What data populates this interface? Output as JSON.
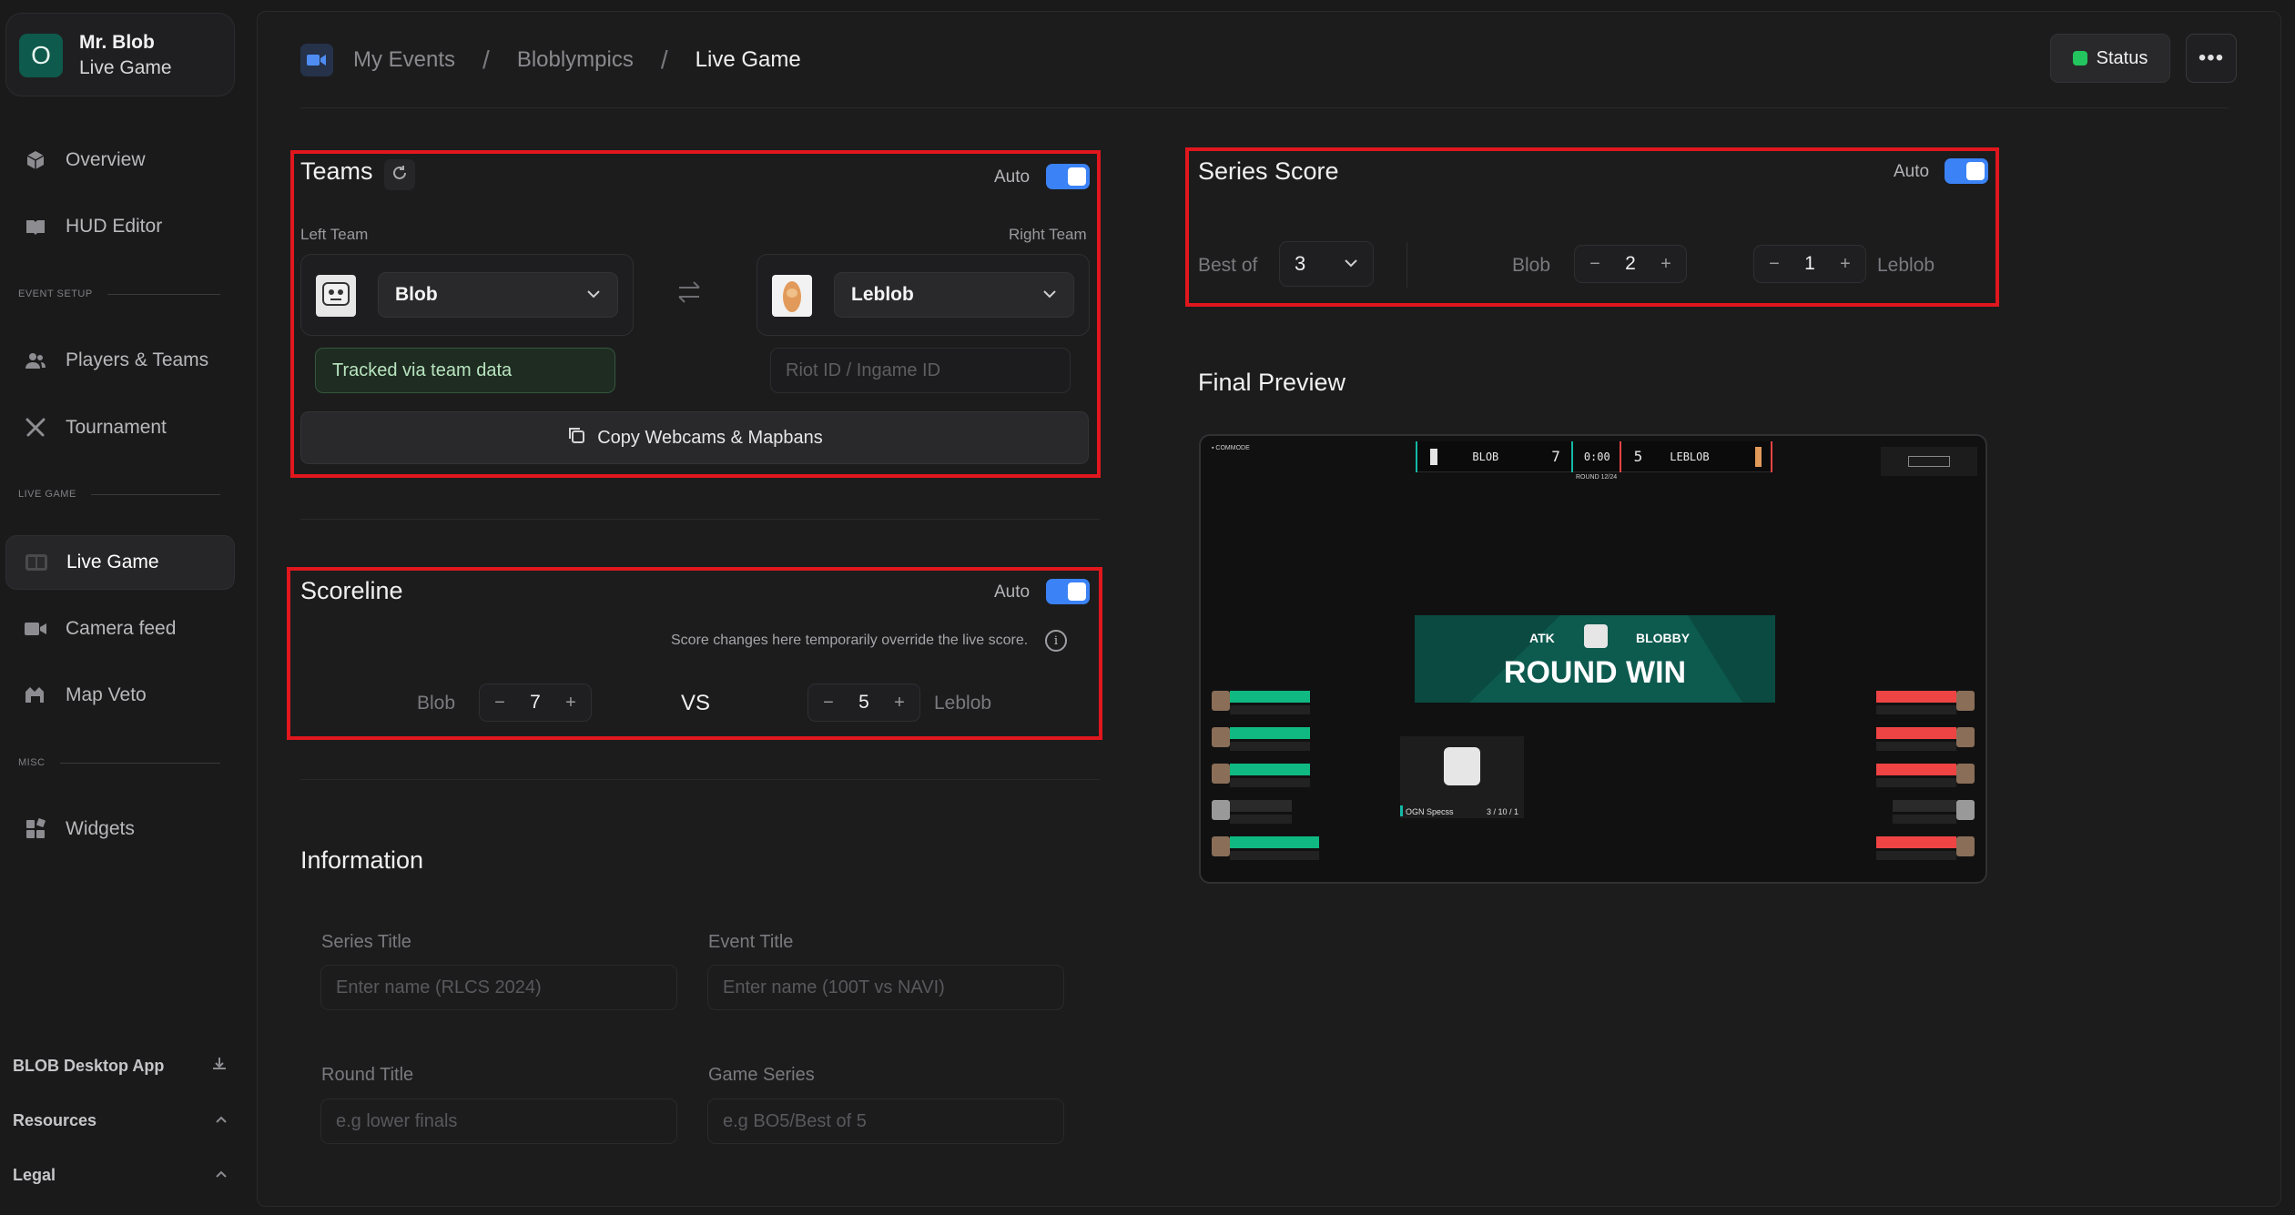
{
  "account": {
    "initial": "O",
    "name": "Mr. Blob",
    "subtitle": "Live Game"
  },
  "sidebar": {
    "items": [
      {
        "label": "Overview",
        "icon": "cube-icon"
      },
      {
        "label": "HUD Editor",
        "icon": "book-icon"
      },
      {
        "label": "Players & Teams",
        "icon": "users-icon"
      },
      {
        "label": "Tournament",
        "icon": "swords-icon"
      },
      {
        "label": "Live Game",
        "icon": "live-game-icon"
      },
      {
        "label": "Camera feed",
        "icon": "video-icon"
      },
      {
        "label": "Map Veto",
        "icon": "map-veto-icon"
      },
      {
        "label": "Widgets",
        "icon": "widgets-icon"
      }
    ],
    "sections": {
      "event_setup": "EVENT SETUP",
      "live_game": "LIVE GAME",
      "misc": "MISC"
    },
    "bottom": {
      "desktop_app": "BLOB Desktop App",
      "resources": "Resources",
      "legal": "Legal"
    }
  },
  "breadcrumb": {
    "items": [
      "My Events",
      "Bloblympics",
      "Live Game"
    ],
    "separator": "/"
  },
  "header": {
    "status_label": "Status",
    "more_label": "•••"
  },
  "teams": {
    "title": "Teams",
    "auto_label": "Auto",
    "auto_on": true,
    "left_label": "Left Team",
    "right_label": "Right Team",
    "left_team": "Blob",
    "right_team": "Leblob",
    "tracked_text": "Tracked via team data",
    "riot_placeholder": "Riot ID / Ingame ID",
    "copy_label": "Copy Webcams & Mapbans"
  },
  "scoreline": {
    "title": "Scoreline",
    "auto_label": "Auto",
    "auto_on": true,
    "note": "Score changes here temporarily override the live score.",
    "left_team": "Blob",
    "left_score": "7",
    "vs": "VS",
    "right_score": "5",
    "right_team": "Leblob",
    "minus": "−",
    "plus": "+"
  },
  "series_score": {
    "title": "Series Score",
    "auto_label": "Auto",
    "auto_on": true,
    "best_of_label": "Best of",
    "best_of_value": "3",
    "left_team": "Blob",
    "left_score": "2",
    "right_score": "1",
    "right_team": "Leblob",
    "minus": "−",
    "plus": "+"
  },
  "preview": {
    "title": "Final Preview",
    "top_left_badge": "▪ COMMODE",
    "left_team": "BLOB",
    "left_score": "7",
    "timer": "0:00",
    "right_score": "5",
    "right_team": "LEBLOB",
    "round_label": "ROUND 12/24",
    "banner_side": "ATK",
    "banner_team": "BLOBBY",
    "banner_text": "ROUND WIN",
    "cam_name": "OGN Specss",
    "cam_kda": "3 / 10 / 1"
  },
  "information": {
    "title": "Information",
    "series_title_label": "Series Title",
    "series_title_placeholder": "Enter name (RLCS 2024)",
    "event_title_label": "Event Title",
    "event_title_placeholder": "Enter name (100T vs NAVI)",
    "round_title_label": "Round Title",
    "round_title_placeholder": "e.g lower finals",
    "game_series_label": "Game Series",
    "game_series_placeholder": "e.g BO5/Best of 5"
  },
  "colors": {
    "accent": "#3b82f6",
    "highlight": "#e0171d",
    "status": "#22c55e",
    "team_left": "#14b8a6",
    "team_right": "#ef4444"
  }
}
